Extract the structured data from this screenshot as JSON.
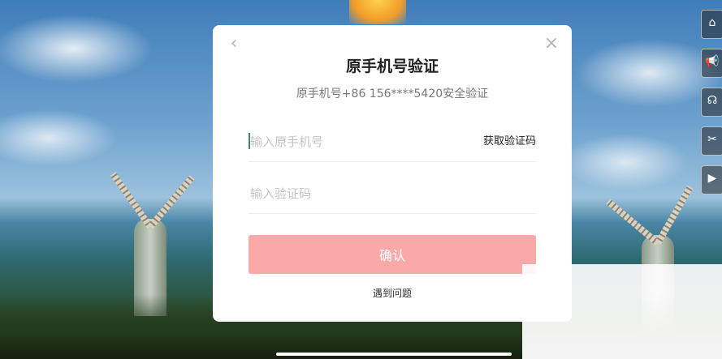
{
  "modal": {
    "back_icon": "chevron-left-icon",
    "close_icon": "close-icon",
    "title": "原手机号验证",
    "subtitle": "原手机号+86 156****5420安全验证",
    "phone_input": {
      "placeholder": "输入原手机号",
      "value": ""
    },
    "get_code_label": "获取验证码",
    "code_input": {
      "placeholder": "输入验证码",
      "value": ""
    },
    "confirm_label": "确认",
    "help_label": "遇到问题"
  },
  "side_icons": [
    "home-icon",
    "megaphone-icon",
    "headset-icon",
    "tools-icon",
    "film-icon"
  ],
  "colors": {
    "confirm_bg": "#f8a9a8",
    "title": "#222222",
    "subtitle": "#777777",
    "placeholder": "#c4c4c4",
    "caret": "#3a8a7a"
  }
}
